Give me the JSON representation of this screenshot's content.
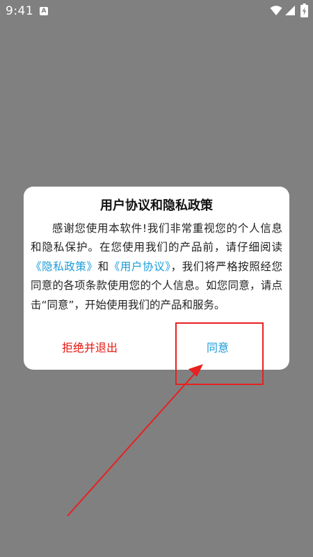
{
  "status_bar": {
    "time": "9:41",
    "notification_icon": "a-notification-icon",
    "wifi_icon": "wifi-icon",
    "signal_icon": "signal-icon",
    "battery_icon": "battery-charging-icon"
  },
  "dialog": {
    "title": "用户协议和隐私政策",
    "body_1": "感谢您使用本软件!我们非常重视您的个人信息和隐私保护。在您使用我们的产品前，请仔细阅读",
    "privacy_link": "《隐私政策》",
    "and_text": "和",
    "user_agreement_link": "《用户协议》",
    "body_2": "，我们将严格按照经您同意的各项条款使用您的个人信息。如您同意，请点击“同意”，开始使用我们的产品和服务。",
    "reject_label": "拒绝并退出",
    "agree_label": "同意"
  },
  "colors": {
    "backdrop": "#808080",
    "link": "#1a9bd8",
    "reject": "#e8140c",
    "annotation": "#e82020"
  }
}
